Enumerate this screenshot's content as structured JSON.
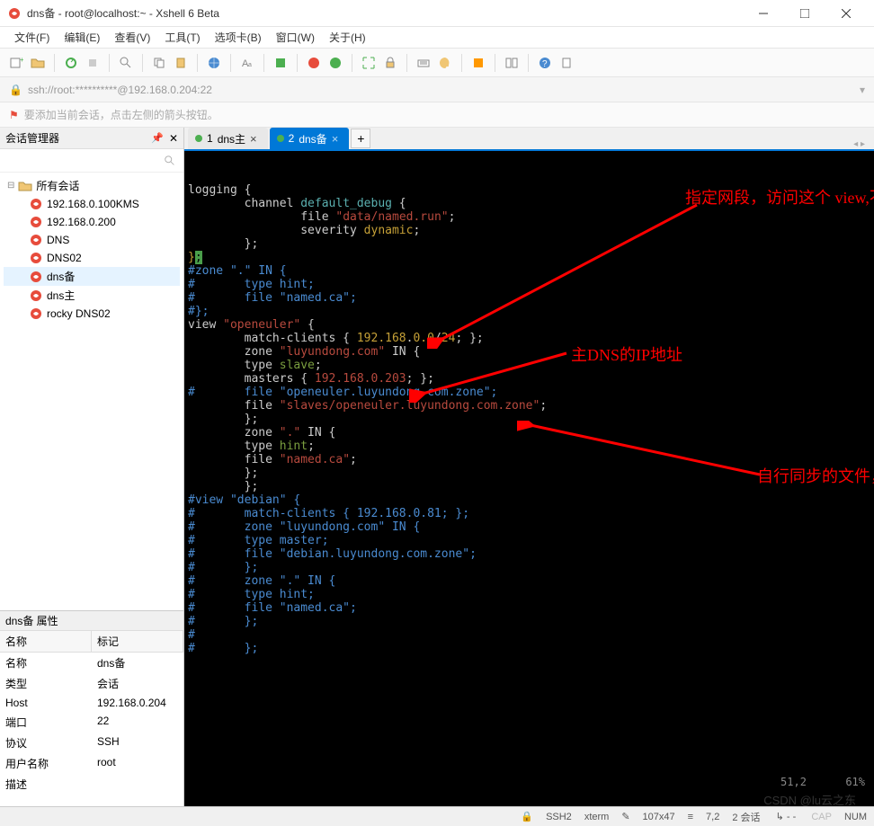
{
  "window": {
    "title": "dns备 - root@localhost:~ - Xshell 6 Beta"
  },
  "menu": [
    "文件(F)",
    "编辑(E)",
    "查看(V)",
    "工具(T)",
    "选项卡(B)",
    "窗口(W)",
    "关于(H)"
  ],
  "addressbar": "ssh://root:**********@192.168.0.204:22",
  "tipbar": "要添加当前会话，点击左侧的箭头按钮。",
  "sidebar": {
    "title": "会话管理器",
    "root": "所有会话",
    "items": [
      "192.168.0.100KMS",
      "192.168.0.200",
      "DNS",
      "DNS02",
      "dns备",
      "dns主",
      "rocky DNS02"
    ],
    "selected_index": 4
  },
  "props": {
    "title": "dns备 属性",
    "header": [
      "名称",
      "标记"
    ],
    "rows": [
      [
        "名称",
        "dns备"
      ],
      [
        "类型",
        "会话"
      ],
      [
        "Host",
        "192.168.0.204"
      ],
      [
        "端口",
        "22"
      ],
      [
        "协议",
        "SSH"
      ],
      [
        "用户名称",
        "root"
      ],
      [
        "描述",
        ""
      ]
    ]
  },
  "tabs": [
    {
      "index": "1",
      "label": "dns主",
      "active": false,
      "dot": "#4caf50"
    },
    {
      "index": "2",
      "label": "dns备",
      "active": true,
      "dot": "#4caf50"
    }
  ],
  "terminal": {
    "lines": [
      [
        {
          "t": "logging {",
          "c": "c-white"
        }
      ],
      [
        {
          "t": "        channel ",
          "c": "c-white"
        },
        {
          "t": "default_debug",
          "c": "c-cyan"
        },
        {
          "t": " {",
          "c": "c-white"
        }
      ],
      [
        {
          "t": "                file ",
          "c": "c-white"
        },
        {
          "t": "\"data/named.run\"",
          "c": "c-red"
        },
        {
          "t": ";",
          "c": "c-white"
        }
      ],
      [
        {
          "t": "                severity ",
          "c": "c-white"
        },
        {
          "t": "dynamic",
          "c": "c-yellow"
        },
        {
          "t": ";",
          "c": "c-white"
        }
      ],
      [
        {
          "t": "        };",
          "c": "c-white"
        }
      ],
      [
        {
          "t": "}",
          "c": "c-yellow"
        },
        {
          "t": ";",
          "c": "c-white",
          "cursor": true
        }
      ],
      [
        {
          "t": "",
          "c": "c-white"
        }
      ],
      [
        {
          "t": "#zone \".\" IN {",
          "c": "c-comment"
        }
      ],
      [
        {
          "t": "#       type hint;",
          "c": "c-comment"
        }
      ],
      [
        {
          "t": "#       file \"named.ca\";",
          "c": "c-comment"
        }
      ],
      [
        {
          "t": "#};",
          "c": "c-comment"
        }
      ],
      [
        {
          "t": "",
          "c": "c-white"
        }
      ],
      [
        {
          "t": "view ",
          "c": "c-white"
        },
        {
          "t": "\"openeuler\"",
          "c": "c-red"
        },
        {
          "t": " {",
          "c": "c-white"
        }
      ],
      [
        {
          "t": "        match-clients { ",
          "c": "c-white"
        },
        {
          "t": "192.168",
          "c": "c-yellow"
        },
        {
          "t": ".",
          "c": "c-white"
        },
        {
          "t": "0.0",
          "c": "c-yellow"
        },
        {
          "t": "/",
          "c": "c-white"
        },
        {
          "t": "24",
          "c": "c-yellow"
        },
        {
          "t": "; };",
          "c": "c-white"
        }
      ],
      [
        {
          "t": "        zone ",
          "c": "c-white"
        },
        {
          "t": "\"luyundong.com\"",
          "c": "c-red"
        },
        {
          "t": " IN {",
          "c": "c-white"
        }
      ],
      [
        {
          "t": "        type ",
          "c": "c-white"
        },
        {
          "t": "slave",
          "c": "c-green"
        },
        {
          "t": ";",
          "c": "c-white"
        }
      ],
      [
        {
          "t": "        masters { ",
          "c": "c-white"
        },
        {
          "t": "192.168.0.203",
          "c": "c-red"
        },
        {
          "t": "; };",
          "c": "c-white"
        }
      ],
      [
        {
          "t": "#       file \"openeuler.luyundong.com.zone\";",
          "c": "c-comment"
        }
      ],
      [
        {
          "t": "        file ",
          "c": "c-white"
        },
        {
          "t": "\"slaves/openeuler.luyundong.com.zone\"",
          "c": "c-red"
        },
        {
          "t": ";",
          "c": "c-white"
        }
      ],
      [
        {
          "t": "        };",
          "c": "c-white"
        }
      ],
      [
        {
          "t": "        zone ",
          "c": "c-white"
        },
        {
          "t": "\".\"",
          "c": "c-red"
        },
        {
          "t": " IN {",
          "c": "c-white"
        }
      ],
      [
        {
          "t": "        type ",
          "c": "c-white"
        },
        {
          "t": "hint",
          "c": "c-green"
        },
        {
          "t": ";",
          "c": "c-white"
        }
      ],
      [
        {
          "t": "        file ",
          "c": "c-white"
        },
        {
          "t": "\"named.ca\"",
          "c": "c-red"
        },
        {
          "t": ";",
          "c": "c-white"
        }
      ],
      [
        {
          "t": "        };",
          "c": "c-white"
        }
      ],
      [
        {
          "t": "",
          "c": "c-white"
        }
      ],
      [
        {
          "t": "        };",
          "c": "c-white"
        }
      ],
      [
        {
          "t": "",
          "c": "c-white"
        }
      ],
      [
        {
          "t": "#view \"debian\" {",
          "c": "c-comment"
        }
      ],
      [
        {
          "t": "#       match-clients { 192.168.0.81; };",
          "c": "c-comment"
        }
      ],
      [
        {
          "t": "#       zone \"luyundong.com\" IN {",
          "c": "c-comment"
        }
      ],
      [
        {
          "t": "#       type master;",
          "c": "c-comment"
        }
      ],
      [
        {
          "t": "#       file \"debian.luyundong.com.zone\";",
          "c": "c-comment"
        }
      ],
      [
        {
          "t": "#       };",
          "c": "c-comment"
        }
      ],
      [
        {
          "t": "#       zone \".\" IN {",
          "c": "c-comment"
        }
      ],
      [
        {
          "t": "#       type hint;",
          "c": "c-comment"
        }
      ],
      [
        {
          "t": "#       file \"named.ca\";",
          "c": "c-comment"
        }
      ],
      [
        {
          "t": "#       };",
          "c": "c-comment"
        }
      ],
      [
        {
          "t": "#",
          "c": "c-comment"
        }
      ],
      [
        {
          "t": "#       };",
          "c": "c-comment"
        }
      ]
    ],
    "pos": "51,2",
    "percent": "61%"
  },
  "annotations": {
    "a1": "指定网段，访问这个 view,不是主备的相关配置内容",
    "a2": "主DNS的IP地址",
    "a3": "自行同步的文件，无需手动创建"
  },
  "statusbar": {
    "conn": "SSH2",
    "term": "xterm",
    "size": "107x47",
    "cursor": "7,2",
    "sessions": "2 会话",
    "cap": "CAP",
    "num": "NUM"
  },
  "watermark": "CSDN @lu云之东"
}
